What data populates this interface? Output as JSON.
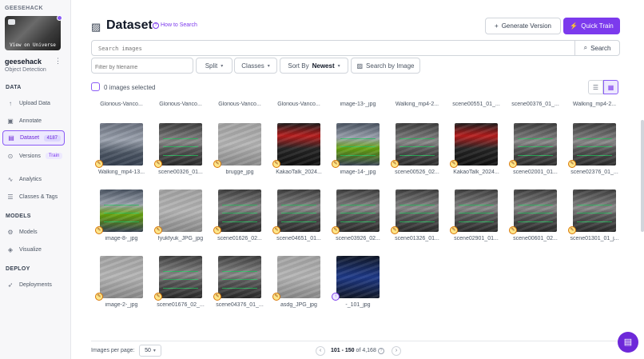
{
  "sidebar": {
    "workspace_label": "GEESEHACK",
    "project_thumb_text": "View on Universe",
    "project_name": "geesehack",
    "project_type": "Object Detection",
    "sections": {
      "data": "DATA",
      "models": "MODELS",
      "deploy": "DEPLOY"
    },
    "items": [
      {
        "label": "Upload Data",
        "icon": "upload-icon"
      },
      {
        "label": "Annotate",
        "icon": "annotate-icon"
      },
      {
        "label": "Dataset",
        "icon": "dataset-icon",
        "badge": "4187",
        "active": true
      },
      {
        "label": "Versions",
        "icon": "versions-icon",
        "badge": "Train"
      },
      {
        "label": "Analytics",
        "icon": "analytics-icon"
      },
      {
        "label": "Classes & Tags",
        "icon": "list-icon"
      },
      {
        "label": "Models",
        "icon": "models-icon"
      },
      {
        "label": "Visualize",
        "icon": "visualize-icon"
      },
      {
        "label": "Deployments",
        "icon": "rocket-icon"
      }
    ]
  },
  "header": {
    "title": "Dataset",
    "how_to_search": "How to Search",
    "generate_version": "Generate Version",
    "quick_train": "Quick Train"
  },
  "search": {
    "placeholder": "Search images",
    "button": "Search"
  },
  "filters": {
    "filename_placeholder": "Filter by filename",
    "split": "Split",
    "classes": "Classes",
    "sort_label": "Sort By",
    "sort_value": "Newest",
    "search_by_image": "Search by Image"
  },
  "selection": {
    "text": "0 images selected"
  },
  "top_captions": [
    "Glorious-Vanco...",
    "Glorious-Vanco...",
    "Glorious-Vanco...",
    "Glorious-Vanco...",
    "image-13-_jpg",
    "Walking_mp4-2...",
    "scene00551_01_...",
    "scene00376_01_...",
    "Walking_mp4-2..."
  ],
  "images": [
    {
      "name": "Walking_mp4-13...",
      "tag": "edit"
    },
    {
      "name": "scene00326_01...",
      "tag": "edit"
    },
    {
      "name": "brugge_jpg",
      "tag": "edit"
    },
    {
      "name": "KakaoTalk_2024...",
      "tag": "edit"
    },
    {
      "name": "image-14-_jpg",
      "tag": "edit"
    },
    {
      "name": "scene00526_02...",
      "tag": "edit"
    },
    {
      "name": "KakaoTalk_2024...",
      "tag": "edit"
    },
    {
      "name": "scene02001_01...",
      "tag": "edit"
    },
    {
      "name": "scene02376_01_...",
      "tag": "edit"
    },
    {
      "name": "image-8-_jpg",
      "tag": "edit"
    },
    {
      "name": "fyukfyuk_JPG_jpg",
      "tag": "edit"
    },
    {
      "name": "scene01626_02...",
      "tag": "edit"
    },
    {
      "name": "scene04651_01...",
      "tag": "edit"
    },
    {
      "name": "scene03926_02...",
      "tag": "edit"
    },
    {
      "name": "scene01326_01...",
      "tag": "edit"
    },
    {
      "name": "scene02901_01...",
      "tag": "edit"
    },
    {
      "name": "scene00601_02...",
      "tag": "edit"
    },
    {
      "name": "scene01301_01_j...",
      "tag": "edit"
    },
    {
      "name": "image-2-_jpg",
      "tag": "edit"
    },
    {
      "name": "scene01676_02_...",
      "tag": "edit"
    },
    {
      "name": "scene04376_01_...",
      "tag": "edit"
    },
    {
      "name": "asdg_JPG_jpg",
      "tag": "edit"
    },
    {
      "name": "-_101_jpg",
      "tag": "upload"
    }
  ],
  "footer": {
    "per_page_label": "Images per page:",
    "per_page_value": "50",
    "range": "101 - 150",
    "of_text": "of 4,168"
  },
  "colors": {
    "accent": "#7c3aed",
    "accent_light": "#ede9fe"
  }
}
